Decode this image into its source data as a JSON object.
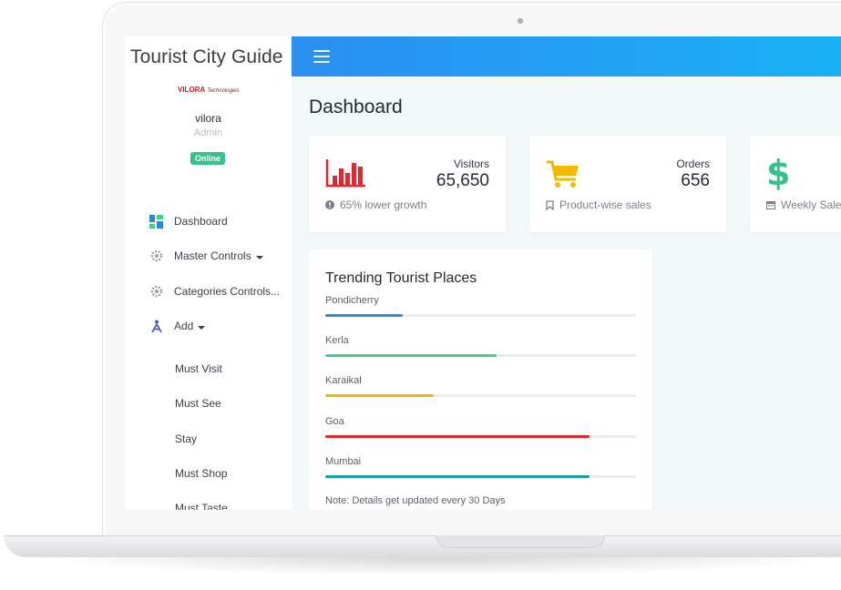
{
  "app": {
    "title": "Tourist City Guide"
  },
  "logo": {
    "brand": "VILORA",
    "sub": "Technologies"
  },
  "user": {
    "name": "vilora",
    "role": "Admin",
    "status": "Online"
  },
  "sidebar": {
    "items": [
      {
        "label": "Dashboard",
        "icon": "dashboard-icon"
      },
      {
        "label": "Master Controls",
        "icon": "gear-icon"
      },
      {
        "label": "Categories Controls...",
        "icon": "gear-icon"
      },
      {
        "label": "Add",
        "icon": "add-figure-icon"
      }
    ],
    "sub_items": [
      "Must Visit",
      "Must See",
      "Stay",
      "Must Shop",
      "Must Taste"
    ]
  },
  "page": {
    "title": "Dashboard"
  },
  "cards": [
    {
      "label": "Visitors",
      "value": "65,650",
      "foot": "65% lower growth",
      "icon": "bar-chart-icon",
      "color": "#e8242c"
    },
    {
      "label": "Orders",
      "value": "656",
      "foot": "Product-wise sales",
      "icon": "cart-icon",
      "color": "#f5b800"
    },
    {
      "label": "",
      "value": "",
      "foot": "Weekly Sales",
      "icon": "dollar-icon",
      "color": "#35c38d"
    }
  ],
  "trending": {
    "title": "Trending Tourist Places",
    "places": [
      {
        "name": "Pondicherry",
        "percent": 25,
        "color": "#2e86de"
      },
      {
        "name": "Kerla",
        "percent": 55,
        "color": "#3fd18d"
      },
      {
        "name": "Karaikal",
        "percent": 35,
        "color": "#f5b800"
      },
      {
        "name": "Goa",
        "percent": 85,
        "color": "#e8242c"
      },
      {
        "name": "Mumbai",
        "percent": 85,
        "color": "#1b9aaa"
      }
    ],
    "note": "Note: Details get updated every 30 Days"
  }
}
